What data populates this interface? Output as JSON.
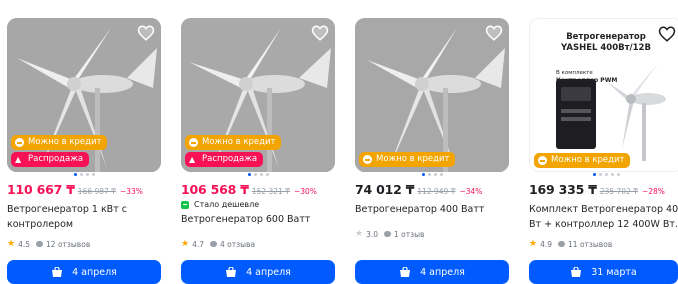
{
  "products": [
    {
      "price": "110 667 ₸",
      "old_price": "166 987 ₸",
      "discount": "−33%",
      "title_line1": "Ветрогенератор 1 кВт с",
      "title_line2": "контролером",
      "rating": "4.5",
      "reviews": "12 отзывов",
      "badges": [
        "Можно в кредит",
        "Распродажа"
      ],
      "cart_label": "4 апреля"
    },
    {
      "price": "106 568 ₸",
      "old_price": "152 321 ₸",
      "discount": "−30%",
      "cheaper": "Стало дешевле",
      "title_line1": "Ветрогенератор 600 Ватт",
      "rating": "4.7",
      "reviews": "4 отзыва",
      "badges": [
        "Можно в кредит",
        "Распродажа"
      ],
      "cart_label": "4 апреля"
    },
    {
      "price": "74 012 ₸",
      "old_price": "112 949 ₸",
      "discount": "−34%",
      "title_line1": "Ветрогенератор 400 Ватт",
      "rating": "3.0",
      "reviews": "1 отзыв",
      "badges": [
        "Можно в кредит"
      ],
      "cart_label": "4 апреля"
    },
    {
      "price": "169 335 ₸",
      "old_price": "235 702 ₸",
      "discount": "−28%",
      "title_line1": "Комплект Ветрогенератор 400",
      "title_line2": "Вт + контроллер 12 400W Вт...",
      "rating": "4.9",
      "reviews": "11 отзывов",
      "badges": [
        "Можно в кредит"
      ],
      "cart_label": "31 марта",
      "promo_title_1": "Ветрогенератор",
      "promo_title_2": "YASHEL 400Вт/12В",
      "promo_sub_1": "В комплекте",
      "promo_sub_2": "Контроллер PWM"
    }
  ],
  "colors": {
    "accent": "#005bff",
    "sale": "#f91155",
    "credit": "#f2a400",
    "star": "#ffa800",
    "cheaper": "#10c44c"
  },
  "icons": [
    "heart-icon",
    "star-icon",
    "comment-icon",
    "shopping-bag-icon",
    "fire-icon",
    "credit-icon"
  ]
}
